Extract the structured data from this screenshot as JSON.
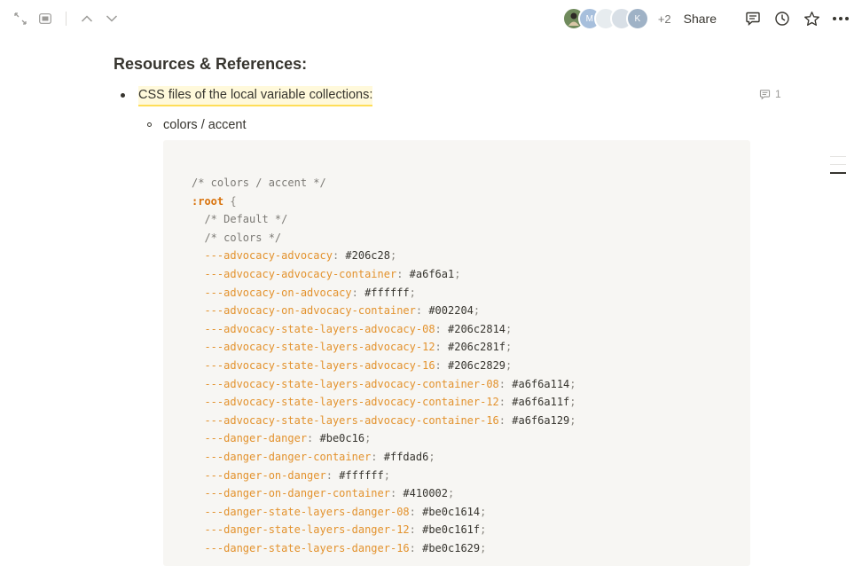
{
  "topbar": {
    "collaborators_extra": "+2",
    "share_label": "Share",
    "avatar_letters": [
      "M",
      "K"
    ]
  },
  "page": {
    "heading": "Resources & References:",
    "bullet": "CSS files of the local variable collections:",
    "comment_count": "1",
    "sub_bullet": "colors / accent"
  },
  "code": {
    "lines": [
      {
        "type": "comment",
        "text": "/* colors / accent */"
      },
      {
        "type": "open",
        "selector": ":root",
        "brace": " {"
      },
      {
        "type": "comment-indent",
        "text": "/* Default */"
      },
      {
        "type": "comment-indent",
        "text": "/* colors */"
      },
      {
        "type": "decl",
        "prop": "---advocacy-advocacy",
        "value": "#206c28"
      },
      {
        "type": "decl",
        "prop": "---advocacy-advocacy-container",
        "value": "#a6f6a1"
      },
      {
        "type": "decl",
        "prop": "---advocacy-on-advocacy",
        "value": "#ffffff"
      },
      {
        "type": "decl",
        "prop": "---advocacy-on-advocacy-container",
        "value": "#002204"
      },
      {
        "type": "decl",
        "prop": "---advocacy-state-layers-advocacy-08",
        "value": "#206c2814"
      },
      {
        "type": "decl",
        "prop": "---advocacy-state-layers-advocacy-12",
        "value": "#206c281f"
      },
      {
        "type": "decl",
        "prop": "---advocacy-state-layers-advocacy-16",
        "value": "#206c2829"
      },
      {
        "type": "decl",
        "prop": "---advocacy-state-layers-advocacy-container-08",
        "value": "#a6f6a114"
      },
      {
        "type": "decl",
        "prop": "---advocacy-state-layers-advocacy-container-12",
        "value": "#a6f6a11f"
      },
      {
        "type": "decl",
        "prop": "---advocacy-state-layers-advocacy-container-16",
        "value": "#a6f6a129"
      },
      {
        "type": "decl",
        "prop": "---danger-danger",
        "value": "#be0c16"
      },
      {
        "type": "decl",
        "prop": "---danger-danger-container",
        "value": "#ffdad6"
      },
      {
        "type": "decl",
        "prop": "---danger-on-danger",
        "value": "#ffffff"
      },
      {
        "type": "decl",
        "prop": "---danger-on-danger-container",
        "value": "#410002"
      },
      {
        "type": "decl",
        "prop": "---danger-state-layers-danger-08",
        "value": "#be0c1614"
      },
      {
        "type": "decl",
        "prop": "---danger-state-layers-danger-12",
        "value": "#be0c161f"
      },
      {
        "type": "decl",
        "prop": "---danger-state-layers-danger-16",
        "value": "#be0c1629"
      }
    ]
  },
  "colors": {
    "css_property": "#e3922d",
    "comment_highlight": "#ffcb00",
    "code_background": "#f7f6f3"
  }
}
